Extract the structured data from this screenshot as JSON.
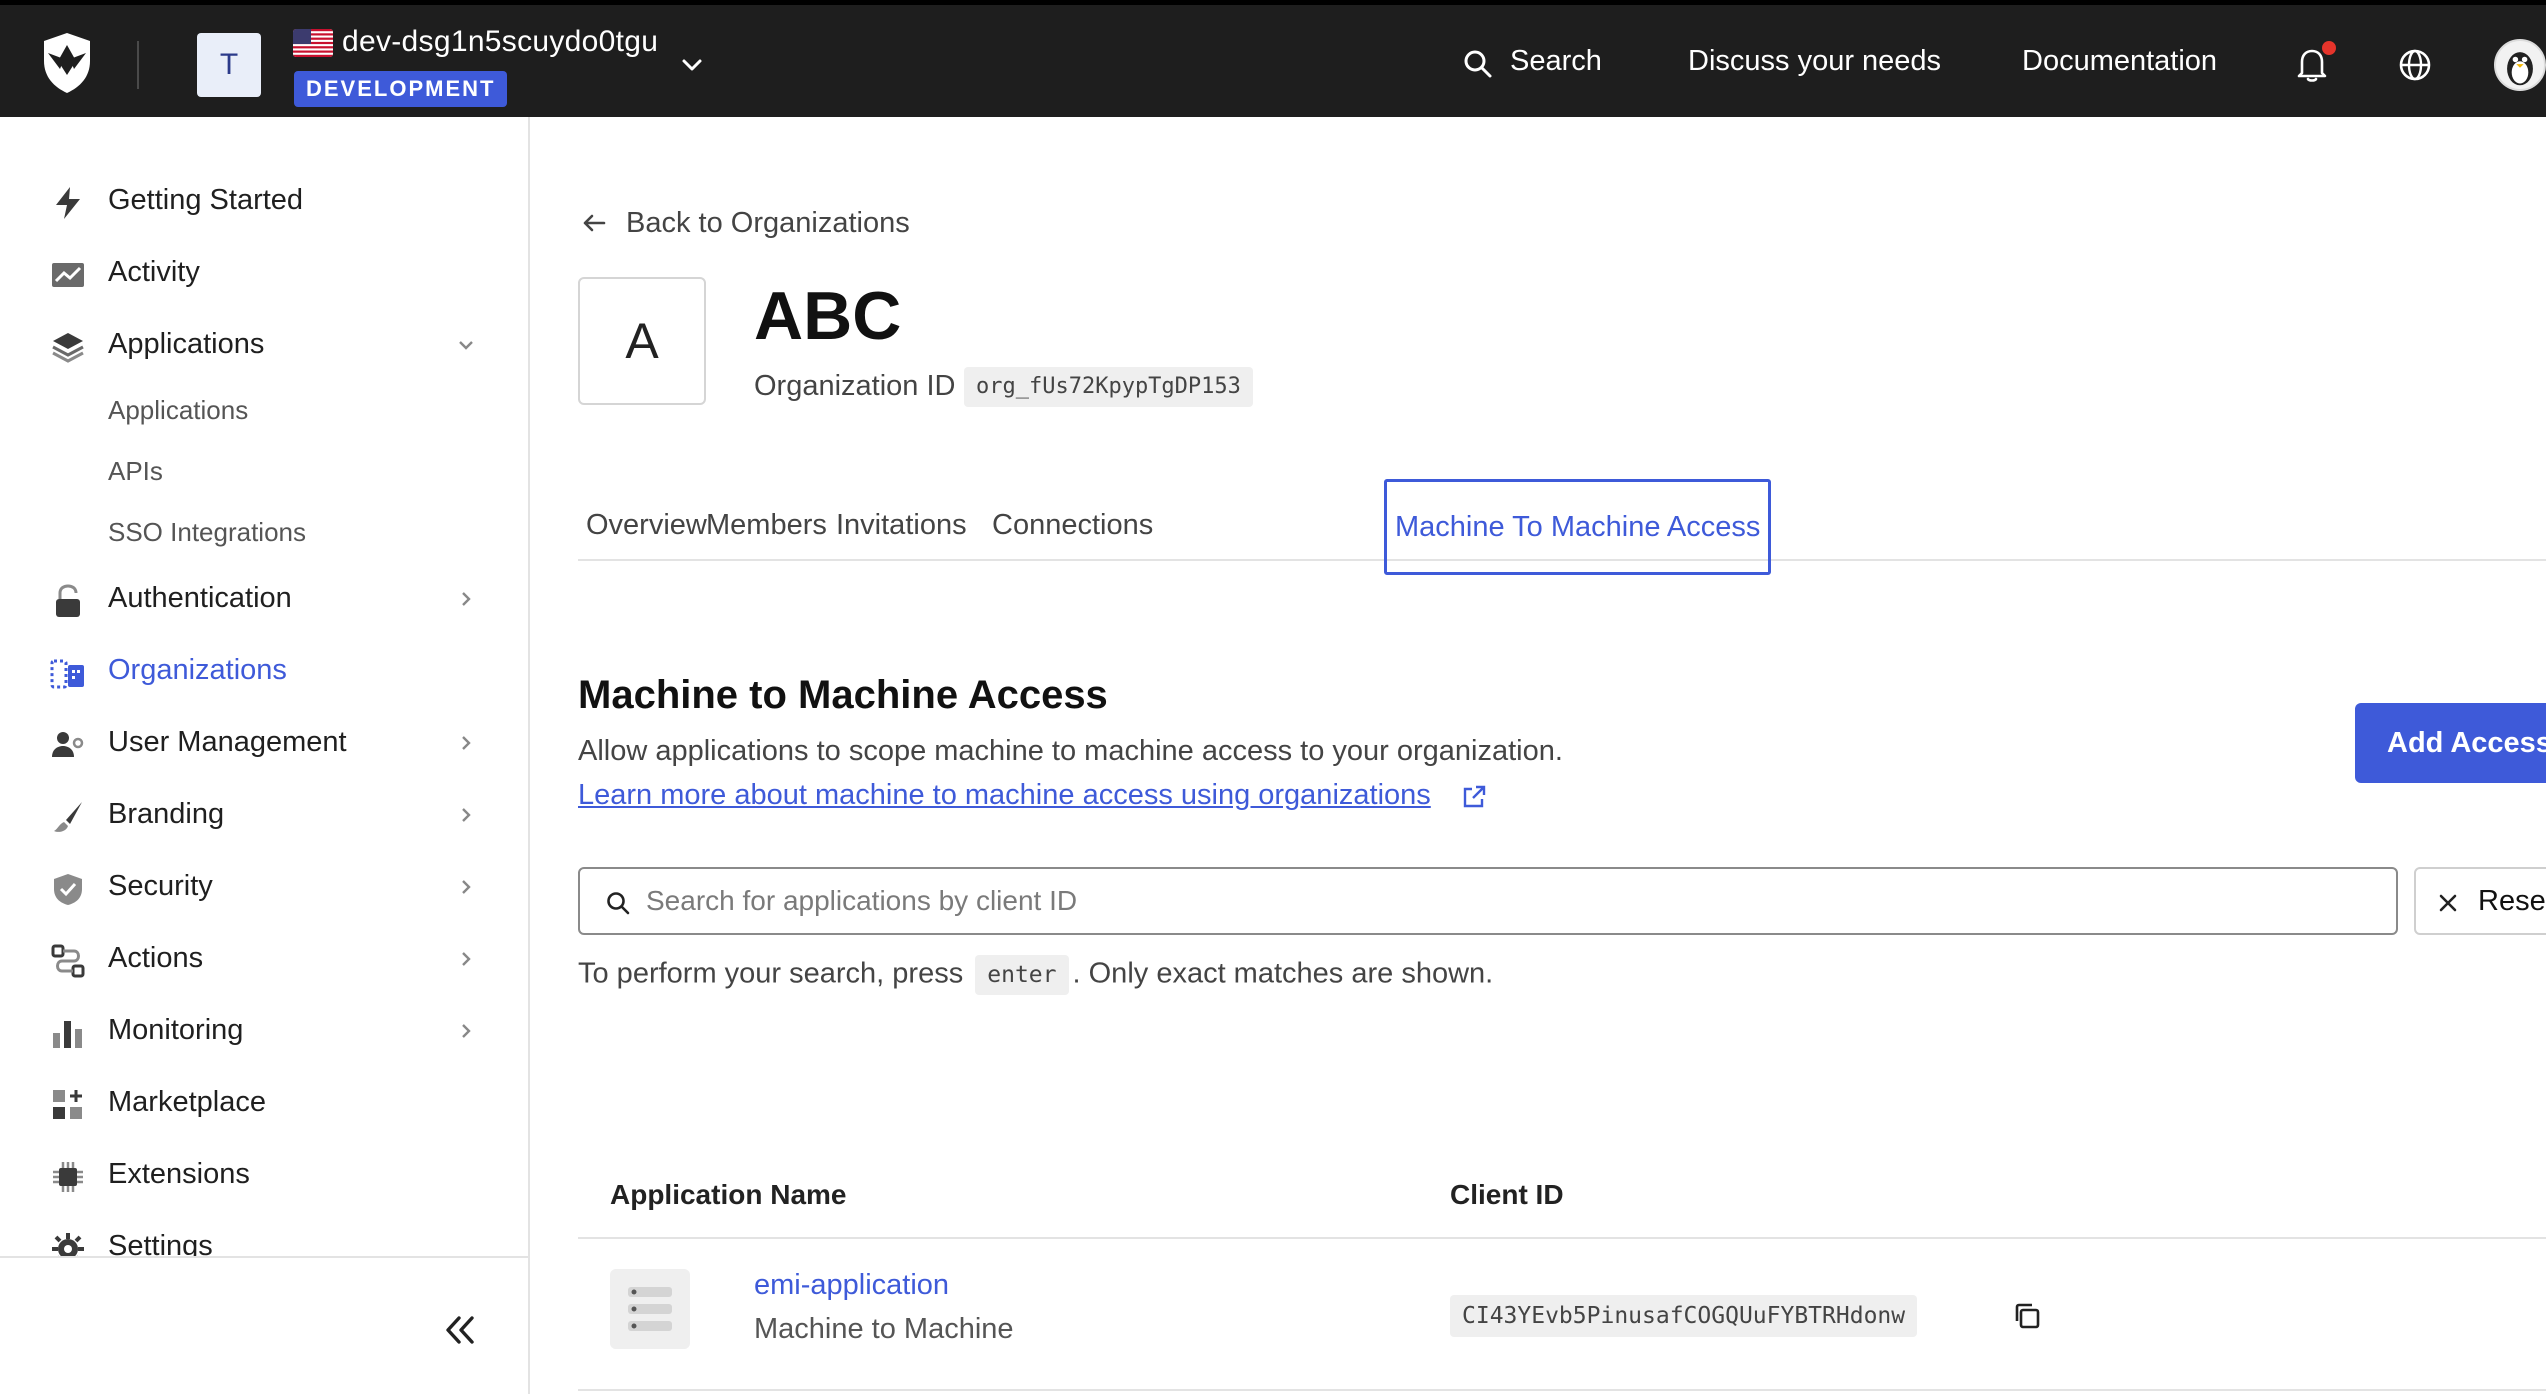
{
  "topbar": {
    "tenant_initial": "T",
    "tenant_name": "dev-dsg1n5scuydo0tgu",
    "environment": "DEVELOPMENT",
    "search_label": "Search",
    "discuss_label": "Discuss your needs",
    "docs_label": "Documentation",
    "icons": [
      "shield-logo-icon",
      "us-flag-icon",
      "chevron-down-icon",
      "search-icon",
      "bell-icon",
      "globe-icon",
      "avatar"
    ],
    "accent": "#3e5ad9",
    "bg": "#1e1e1e",
    "notification_dot": "#e5342b"
  },
  "sidebar": {
    "items": [
      {
        "label": "Getting Started",
        "icon": "bolt-icon"
      },
      {
        "label": "Activity",
        "icon": "trend-icon"
      },
      {
        "label": "Applications",
        "icon": "layers-icon",
        "expanded": true
      },
      {
        "label": "Authentication",
        "icon": "lock-icon"
      },
      {
        "label": "Organizations",
        "icon": "building-icon",
        "active": true
      },
      {
        "label": "User Management",
        "icon": "users-icon"
      },
      {
        "label": "Branding",
        "icon": "brush-icon"
      },
      {
        "label": "Security",
        "icon": "shield-icon"
      },
      {
        "label": "Actions",
        "icon": "flow-icon"
      },
      {
        "label": "Monitoring",
        "icon": "bars-icon"
      },
      {
        "label": "Marketplace",
        "icon": "grid-plus-icon"
      },
      {
        "label": "Extensions",
        "icon": "chip-icon"
      },
      {
        "label": "Settings",
        "icon": "gear-icon"
      }
    ],
    "sub_items": [
      "Applications",
      "APIs",
      "SSO Integrations"
    ],
    "collapse_icon": "double-chevron-left-icon"
  },
  "main": {
    "back_label": "Back to Organizations",
    "org_initial": "A",
    "org_name": "ABC",
    "org_id_label": "Organization ID",
    "org_id": "org_fUs72KpypTgDP153",
    "tabs": [
      "Overview",
      "Members",
      "Invitations",
      "Connections",
      "Machine To Machine Access"
    ],
    "active_tab": "Machine To Machine Access",
    "section_title": "Machine to Machine Access",
    "section_desc": "Allow applications to scope machine to machine access to your organization.",
    "section_link": "Learn more about machine to machine access using organizations",
    "add_button": "Add Access",
    "search_placeholder": "Search for applications by client ID",
    "search_value": "",
    "reset_label": "Reset",
    "hint_before": "To perform your search, press",
    "hint_key": "enter",
    "hint_after": ". Only exact matches are shown.",
    "table": {
      "headers": [
        "Application Name",
        "Client ID"
      ],
      "rows": [
        {
          "name": "emi-application",
          "type": "Machine to Machine",
          "client_id": "CI43YEvb5PinusafCOGQUuFYBTRHdonw"
        }
      ]
    }
  }
}
